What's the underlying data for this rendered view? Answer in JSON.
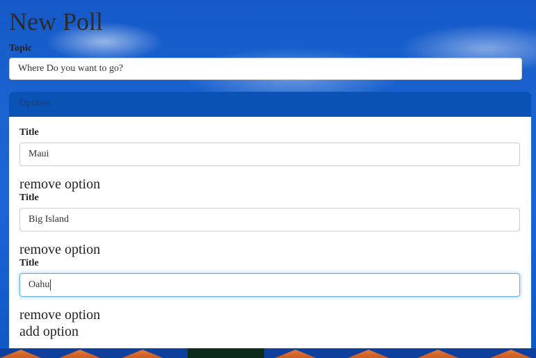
{
  "page": {
    "title": "New Poll"
  },
  "topic": {
    "label": "Topic",
    "value": "Where Do you want to go?"
  },
  "options_panel": {
    "heading": "Options",
    "options": [
      {
        "label": "Title",
        "value": "Maui",
        "remove_label": "remove option"
      },
      {
        "label": "Title",
        "value": "Big Island",
        "remove_label": "remove option"
      },
      {
        "label": "Title",
        "value": "Oahu",
        "remove_label": "remove option",
        "focused": true
      }
    ],
    "add_label": "add option"
  },
  "colors": {
    "panel_heading": "#0b52b5",
    "focus_border": "#66afe9",
    "background_sky": "#1a64d6"
  }
}
